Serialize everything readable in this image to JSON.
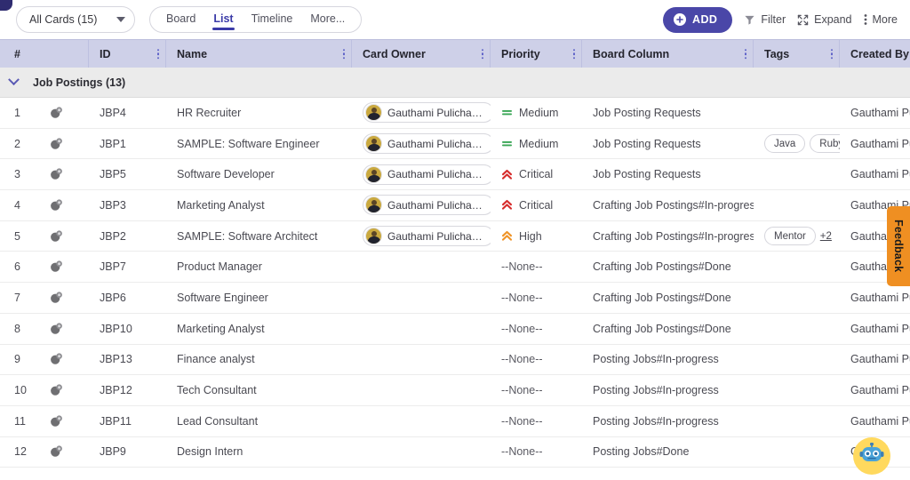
{
  "toolbar": {
    "cards_filter_label": "All Cards (15)",
    "dropdown_icon": "chevron-down-icon",
    "tabs": [
      {
        "label": "Board",
        "active": false
      },
      {
        "label": "List",
        "active": true
      },
      {
        "label": "Timeline",
        "active": false
      },
      {
        "label": "More...",
        "active": false
      }
    ],
    "add_label": "ADD",
    "add_icon": "plus-circle-icon",
    "add_color": "#4a47a8",
    "filter_label": "Filter",
    "filter_icon": "funnel-icon",
    "expand_label": "Expand",
    "expand_icon": "expand-arrows-icon",
    "more_label": "More",
    "more_icon": "kebab-menu-icon"
  },
  "table": {
    "header_bg": "#ced0e8",
    "columns": [
      {
        "label": "#",
        "kebab": false
      },
      {
        "label": "ID",
        "kebab": true
      },
      {
        "label": "Name",
        "kebab": true
      },
      {
        "label": "Card Owner",
        "kebab": true
      },
      {
        "label": "Priority",
        "kebab": true
      },
      {
        "label": "Board Column",
        "kebab": true
      },
      {
        "label": "Tags",
        "kebab": true
      },
      {
        "label": "Created By",
        "kebab": false
      }
    ],
    "group": {
      "label": "Job Postings (13)",
      "expanded": true,
      "toggle_icon": "chevron-down-icon"
    },
    "rows": [
      {
        "num": "1",
        "icon": "card-icon",
        "id": "JBP4",
        "name": "HR Recruiter",
        "owner": "Gauthami Pulicharla",
        "priority": "Medium",
        "priority_icon": "equals-icon",
        "priority_color": "#3aa655",
        "board": "Job Posting Requests",
        "tags": [],
        "tags_more": "",
        "created_by": "Gauthami Pu"
      },
      {
        "num": "2",
        "icon": "card-icon",
        "id": "JBP1",
        "name": "SAMPLE: Software Engineer",
        "owner": "Gauthami Pulicharla",
        "priority": "Medium",
        "priority_icon": "equals-icon",
        "priority_color": "#3aa655",
        "board": "Job Posting Requests",
        "tags": [
          "Java",
          "Ruby"
        ],
        "tags_more": "",
        "created_by": "Gauthami Pu"
      },
      {
        "num": "3",
        "icon": "card-icon",
        "id": "JBP5",
        "name": "Software Developer",
        "owner": "Gauthami Pulicharla",
        "priority": "Critical",
        "priority_icon": "double-chevron-up-icon",
        "priority_color": "#d62b2b",
        "board": "Job Posting Requests",
        "tags": [],
        "tags_more": "",
        "created_by": "Gauthami Pu"
      },
      {
        "num": "4",
        "icon": "card-icon",
        "id": "JBP3",
        "name": "Marketing Analyst",
        "owner": "Gauthami Pulicharla",
        "priority": "Critical",
        "priority_icon": "double-chevron-up-icon",
        "priority_color": "#d62b2b",
        "board": "Crafting Job Postings#In-progress",
        "tags": [],
        "tags_more": "",
        "created_by": "Gauthami Pu"
      },
      {
        "num": "5",
        "icon": "card-icon",
        "id": "JBP2",
        "name": "SAMPLE: Software Architect",
        "owner": "Gauthami Pulicharla",
        "priority": "High",
        "priority_icon": "double-chevron-up-icon",
        "priority_color": "#ef9326",
        "board": "Crafting Job Postings#In-progress",
        "tags": [
          "Mentor"
        ],
        "tags_more": "+2",
        "created_by": "Gauthami Pu"
      },
      {
        "num": "6",
        "icon": "card-icon",
        "id": "JBP7",
        "name": "Product Manager",
        "owner": "",
        "priority": "--None--",
        "priority_icon": "",
        "priority_color": "",
        "board": "Crafting Job Postings#Done",
        "tags": [],
        "tags_more": "",
        "created_by": "Gauthami Pu"
      },
      {
        "num": "7",
        "icon": "card-icon",
        "id": "JBP6",
        "name": "Software Engineer",
        "owner": "",
        "priority": "--None--",
        "priority_icon": "",
        "priority_color": "",
        "board": "Crafting Job Postings#Done",
        "tags": [],
        "tags_more": "",
        "created_by": "Gauthami Pu"
      },
      {
        "num": "8",
        "icon": "card-icon",
        "id": "JBP10",
        "name": "Marketing Analyst",
        "owner": "",
        "priority": "--None--",
        "priority_icon": "",
        "priority_color": "",
        "board": "Crafting Job Postings#Done",
        "tags": [],
        "tags_more": "",
        "created_by": "Gauthami Pu"
      },
      {
        "num": "9",
        "icon": "card-icon",
        "id": "JBP13",
        "name": "Finance analyst",
        "owner": "",
        "priority": "--None--",
        "priority_icon": "",
        "priority_color": "",
        "board": "Posting Jobs#In-progress",
        "tags": [],
        "tags_more": "",
        "created_by": "Gauthami Pu"
      },
      {
        "num": "10",
        "icon": "card-icon",
        "id": "JBP12",
        "name": "Tech Consultant",
        "owner": "",
        "priority": "--None--",
        "priority_icon": "",
        "priority_color": "",
        "board": "Posting Jobs#In-progress",
        "tags": [],
        "tags_more": "",
        "created_by": "Gauthami Pu"
      },
      {
        "num": "11",
        "icon": "card-icon",
        "id": "JBP11",
        "name": "Lead Consultant",
        "owner": "",
        "priority": "--None--",
        "priority_icon": "",
        "priority_color": "",
        "board": "Posting Jobs#In-progress",
        "tags": [],
        "tags_more": "",
        "created_by": "Gauthami Pu"
      },
      {
        "num": "12",
        "icon": "card-icon",
        "id": "JBP9",
        "name": "Design Intern",
        "owner": "",
        "priority": "--None--",
        "priority_icon": "",
        "priority_color": "",
        "board": "Posting Jobs#Done",
        "tags": [],
        "tags_more": "",
        "created_by": "Ga        Pu"
      }
    ]
  },
  "feedback": {
    "label": "Feedback",
    "color": "#ef8f22"
  },
  "assistant": {
    "icon": "robot-icon",
    "bg_color": "#ffd95e"
  }
}
